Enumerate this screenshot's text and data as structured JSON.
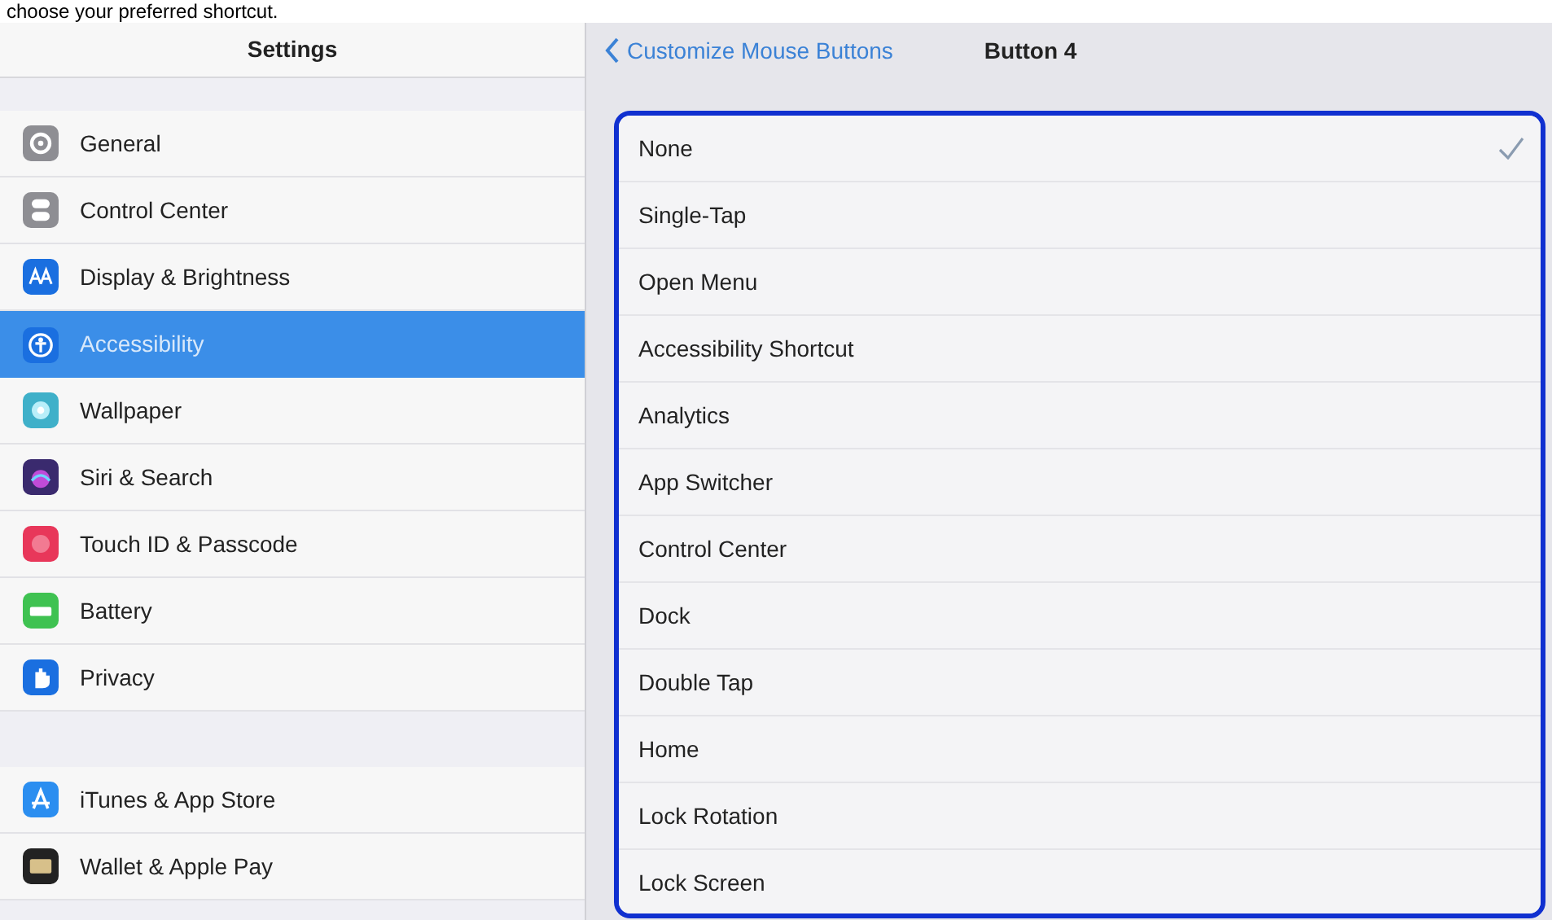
{
  "caption": "choose your preferred shortcut.",
  "sidebar": {
    "title": "Settings",
    "groups": [
      [
        {
          "label": "General",
          "selected": false
        },
        {
          "label": "Control Center",
          "selected": false
        },
        {
          "label": "Display & Brightness",
          "selected": false
        },
        {
          "label": "Accessibility",
          "selected": true
        },
        {
          "label": "Wallpaper",
          "selected": false
        },
        {
          "label": "Siri & Search",
          "selected": false
        },
        {
          "label": "Touch ID & Passcode",
          "selected": false
        },
        {
          "label": "Battery",
          "selected": false
        },
        {
          "label": "Privacy",
          "selected": false
        }
      ],
      [
        {
          "label": "iTunes & App Store",
          "selected": false
        },
        {
          "label": "Wallet & Apple Pay",
          "selected": false
        }
      ]
    ]
  },
  "nav": {
    "back": "Customize Mouse Buttons",
    "title": "Button 4"
  },
  "options": [
    {
      "label": "None",
      "selected": true
    },
    {
      "label": "Single-Tap",
      "selected": false
    },
    {
      "label": "Open Menu",
      "selected": false
    },
    {
      "label": "Accessibility Shortcut",
      "selected": false
    },
    {
      "label": "Analytics",
      "selected": false
    },
    {
      "label": "App Switcher",
      "selected": false
    },
    {
      "label": "Control Center",
      "selected": false
    },
    {
      "label": "Dock",
      "selected": false
    },
    {
      "label": "Double Tap",
      "selected": false
    },
    {
      "label": "Home",
      "selected": false
    },
    {
      "label": "Lock Rotation",
      "selected": false
    },
    {
      "label": "Lock Screen",
      "selected": false
    }
  ]
}
